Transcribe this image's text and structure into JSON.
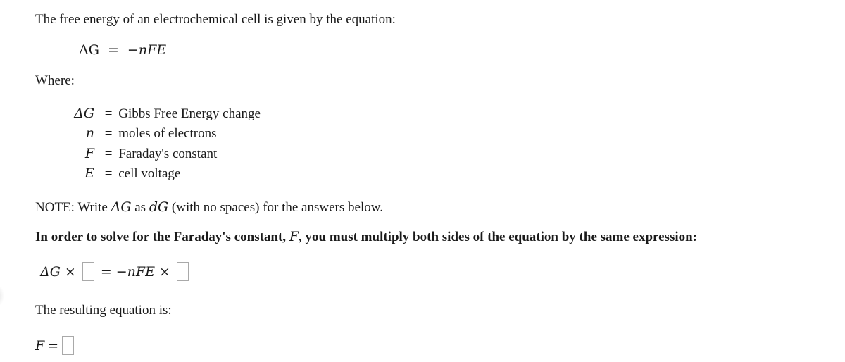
{
  "intro_text": "The free energy of an electrochemical cell is given by the equation:",
  "main_equation": {
    "lhs": "ΔG",
    "equals": "=",
    "rhs": "−nFE"
  },
  "where_label": "Where:",
  "definitions": [
    {
      "symbol": "ΔG",
      "eq": "=",
      "text": "Gibbs Free Energy change"
    },
    {
      "symbol": "n",
      "eq": "=",
      "text": "moles of electrons"
    },
    {
      "symbol": "F",
      "eq": "=",
      "text": "Faraday's constant"
    },
    {
      "symbol": "E",
      "eq": "=",
      "text": "cell voltage"
    }
  ],
  "note": {
    "prefix": "NOTE: Write ",
    "symbol": "ΔG",
    "mid": " as ",
    "replacement": "dG",
    "suffix": " (with no spaces) for the answers below."
  },
  "instruction": {
    "prefix": "In order to solve for the Faraday's constant, ",
    "symbol": "F",
    "suffix": ", you must multiply both sides of the equation by the same expression:"
  },
  "multiply_equation": {
    "lhs": "ΔG",
    "times": "×",
    "equals": "=",
    "rhs": "−nFE",
    "answer_left": "",
    "answer_right": ""
  },
  "result_label": "The resulting equation is:",
  "result_equation": {
    "lhs": "F",
    "equals": "=",
    "answer": ""
  }
}
